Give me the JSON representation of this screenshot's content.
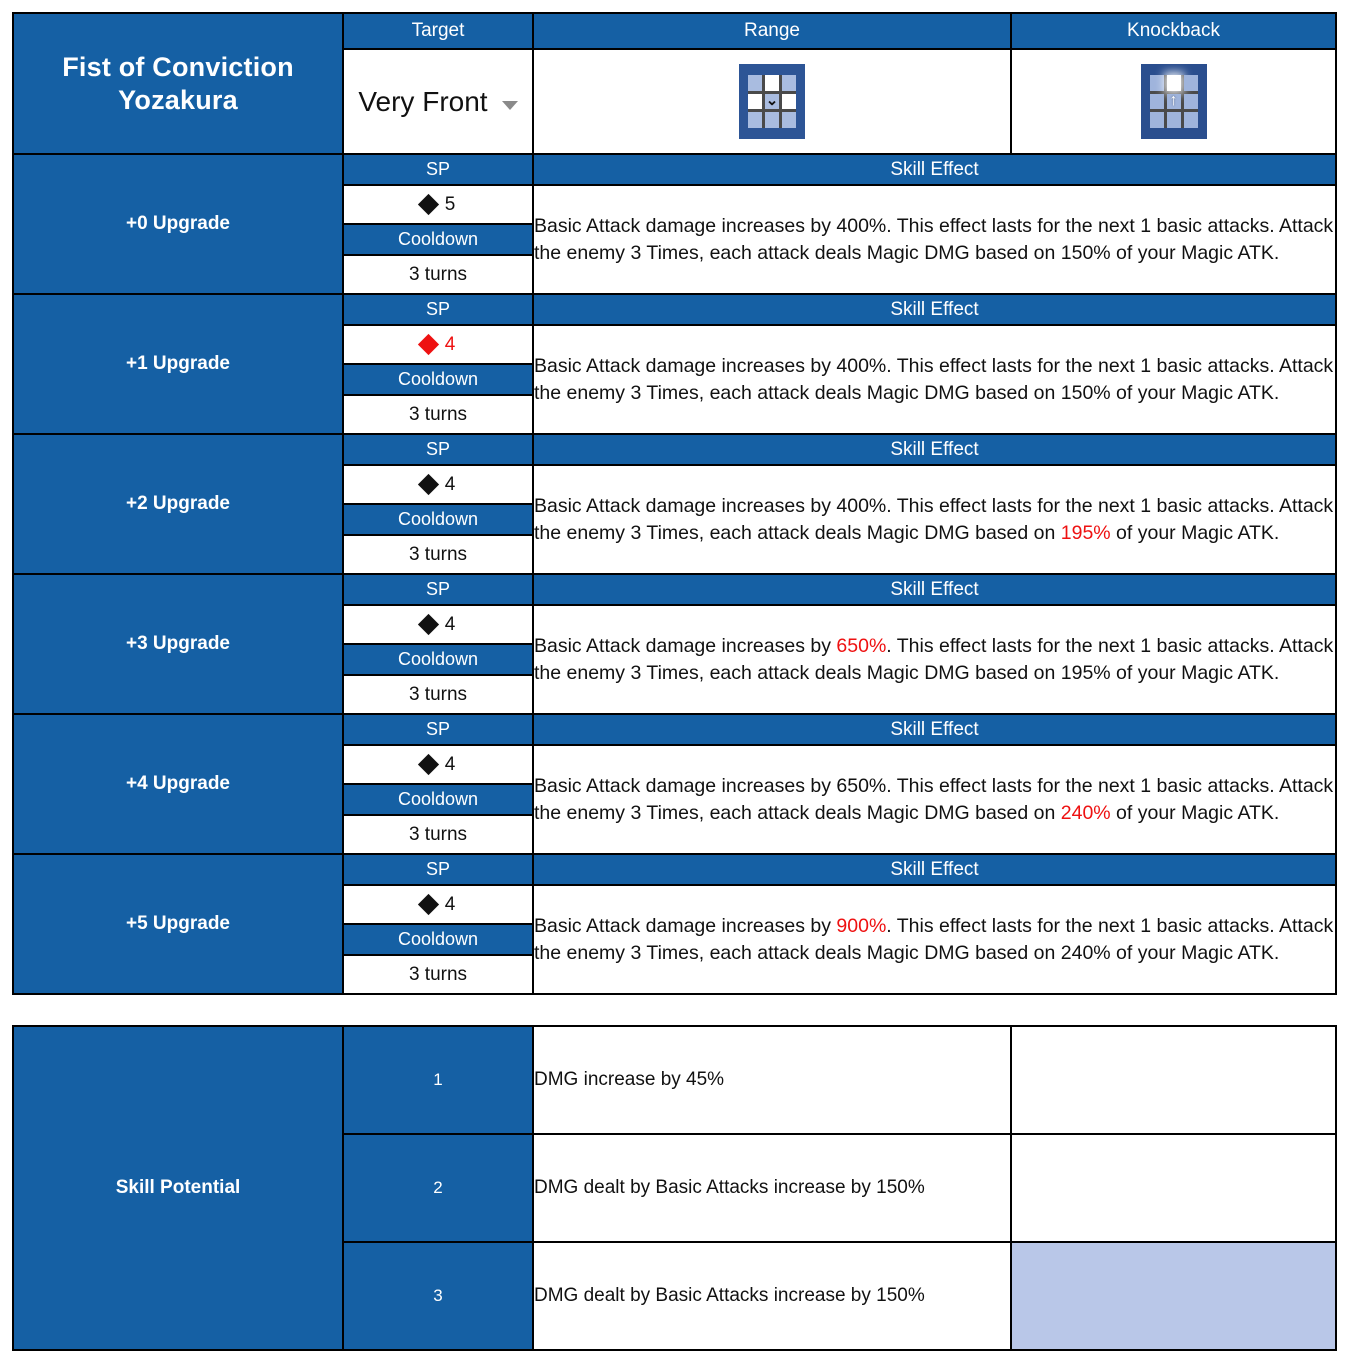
{
  "skill": {
    "name_line1": "Fist of Conviction",
    "name_line2": "Yozakura",
    "headers": {
      "target": "Target",
      "range": "Range",
      "knockback": "Knockback"
    },
    "target_value": "Very Front",
    "target_caret_icon": "chevron-down-icon",
    "range_icon": "range-grid-icon",
    "range_icon_mark": "⌄",
    "knockback_icon": "knockback-grid-icon",
    "knockback_icon_mark": "↑"
  },
  "column_labels": {
    "sp": "SP",
    "cooldown": "Cooldown",
    "skill_effect": "Skill Effect"
  },
  "upgrades": [
    {
      "name": "+0 Upgrade",
      "sp": "5",
      "sp_red": false,
      "cooldown": "3 turns",
      "effect_parts": [
        {
          "t": "Basic Attack damage increases by 400%. This effect lasts for the next 1 basic attacks. Attack the enemy 3 Times, each attack deals Magic DMG based on 150% of your Magic ATK.",
          "red": false
        }
      ]
    },
    {
      "name": "+1 Upgrade",
      "sp": "4",
      "sp_red": true,
      "cooldown": "3 turns",
      "effect_parts": [
        {
          "t": "Basic Attack damage increases by 400%. This effect lasts for the next 1 basic attacks. Attack the enemy 3 Times, each attack deals Magic DMG based on 150% of your Magic ATK.",
          "red": false
        }
      ]
    },
    {
      "name": "+2 Upgrade",
      "sp": "4",
      "sp_red": false,
      "cooldown": "3 turns",
      "effect_parts": [
        {
          "t": "Basic Attack damage increases by 400%. This effect lasts for the next 1 basic attacks. Attack the enemy 3 Times, each attack deals Magic DMG based on ",
          "red": false
        },
        {
          "t": "195%",
          "red": true
        },
        {
          "t": " of your Magic ATK.",
          "red": false
        }
      ]
    },
    {
      "name": "+3 Upgrade",
      "sp": "4",
      "sp_red": false,
      "cooldown": "3 turns",
      "effect_parts": [
        {
          "t": "Basic Attack damage increases by ",
          "red": false
        },
        {
          "t": "650%",
          "red": true
        },
        {
          "t": ". This effect lasts for the next 1 basic attacks. Attack the enemy 3 Times, each attack deals Magic DMG based on 195% of your Magic ATK.",
          "red": false
        }
      ]
    },
    {
      "name": "+4 Upgrade",
      "sp": "4",
      "sp_red": false,
      "cooldown": "3 turns",
      "effect_parts": [
        {
          "t": "Basic Attack damage increases by 650%. This effect lasts for the next 1 basic attacks. Attack the enemy 3 Times, each attack deals Magic DMG based on ",
          "red": false
        },
        {
          "t": "240%",
          "red": true
        },
        {
          "t": " of your Magic ATK.",
          "red": false
        }
      ]
    },
    {
      "name": "+5 Upgrade",
      "sp": "4",
      "sp_red": false,
      "cooldown": "3 turns",
      "effect_parts": [
        {
          "t": "Basic Attack damage increases by ",
          "red": false
        },
        {
          "t": "900%",
          "red": true
        },
        {
          "t": ". This effect lasts for the next 1 basic attacks. Attack the enemy 3 Times, each attack deals Magic DMG based on 240% of your Magic ATK.",
          "red": false
        }
      ]
    }
  ],
  "potential": {
    "label": "Skill Potential",
    "rows": [
      {
        "num": "1",
        "text": "DMG increase by 45%",
        "extra_filled": false
      },
      {
        "num": "2",
        "text": "DMG dealt by Basic Attacks increase by 150%",
        "extra_filled": false
      },
      {
        "num": "3",
        "text": "DMG dealt by Basic Attacks increase by 150%",
        "extra_filled": true
      }
    ]
  },
  "colors": {
    "blue": "#1560a4",
    "red": "#ee1111",
    "lavender": "#b9c7e8",
    "border": "#000000"
  }
}
